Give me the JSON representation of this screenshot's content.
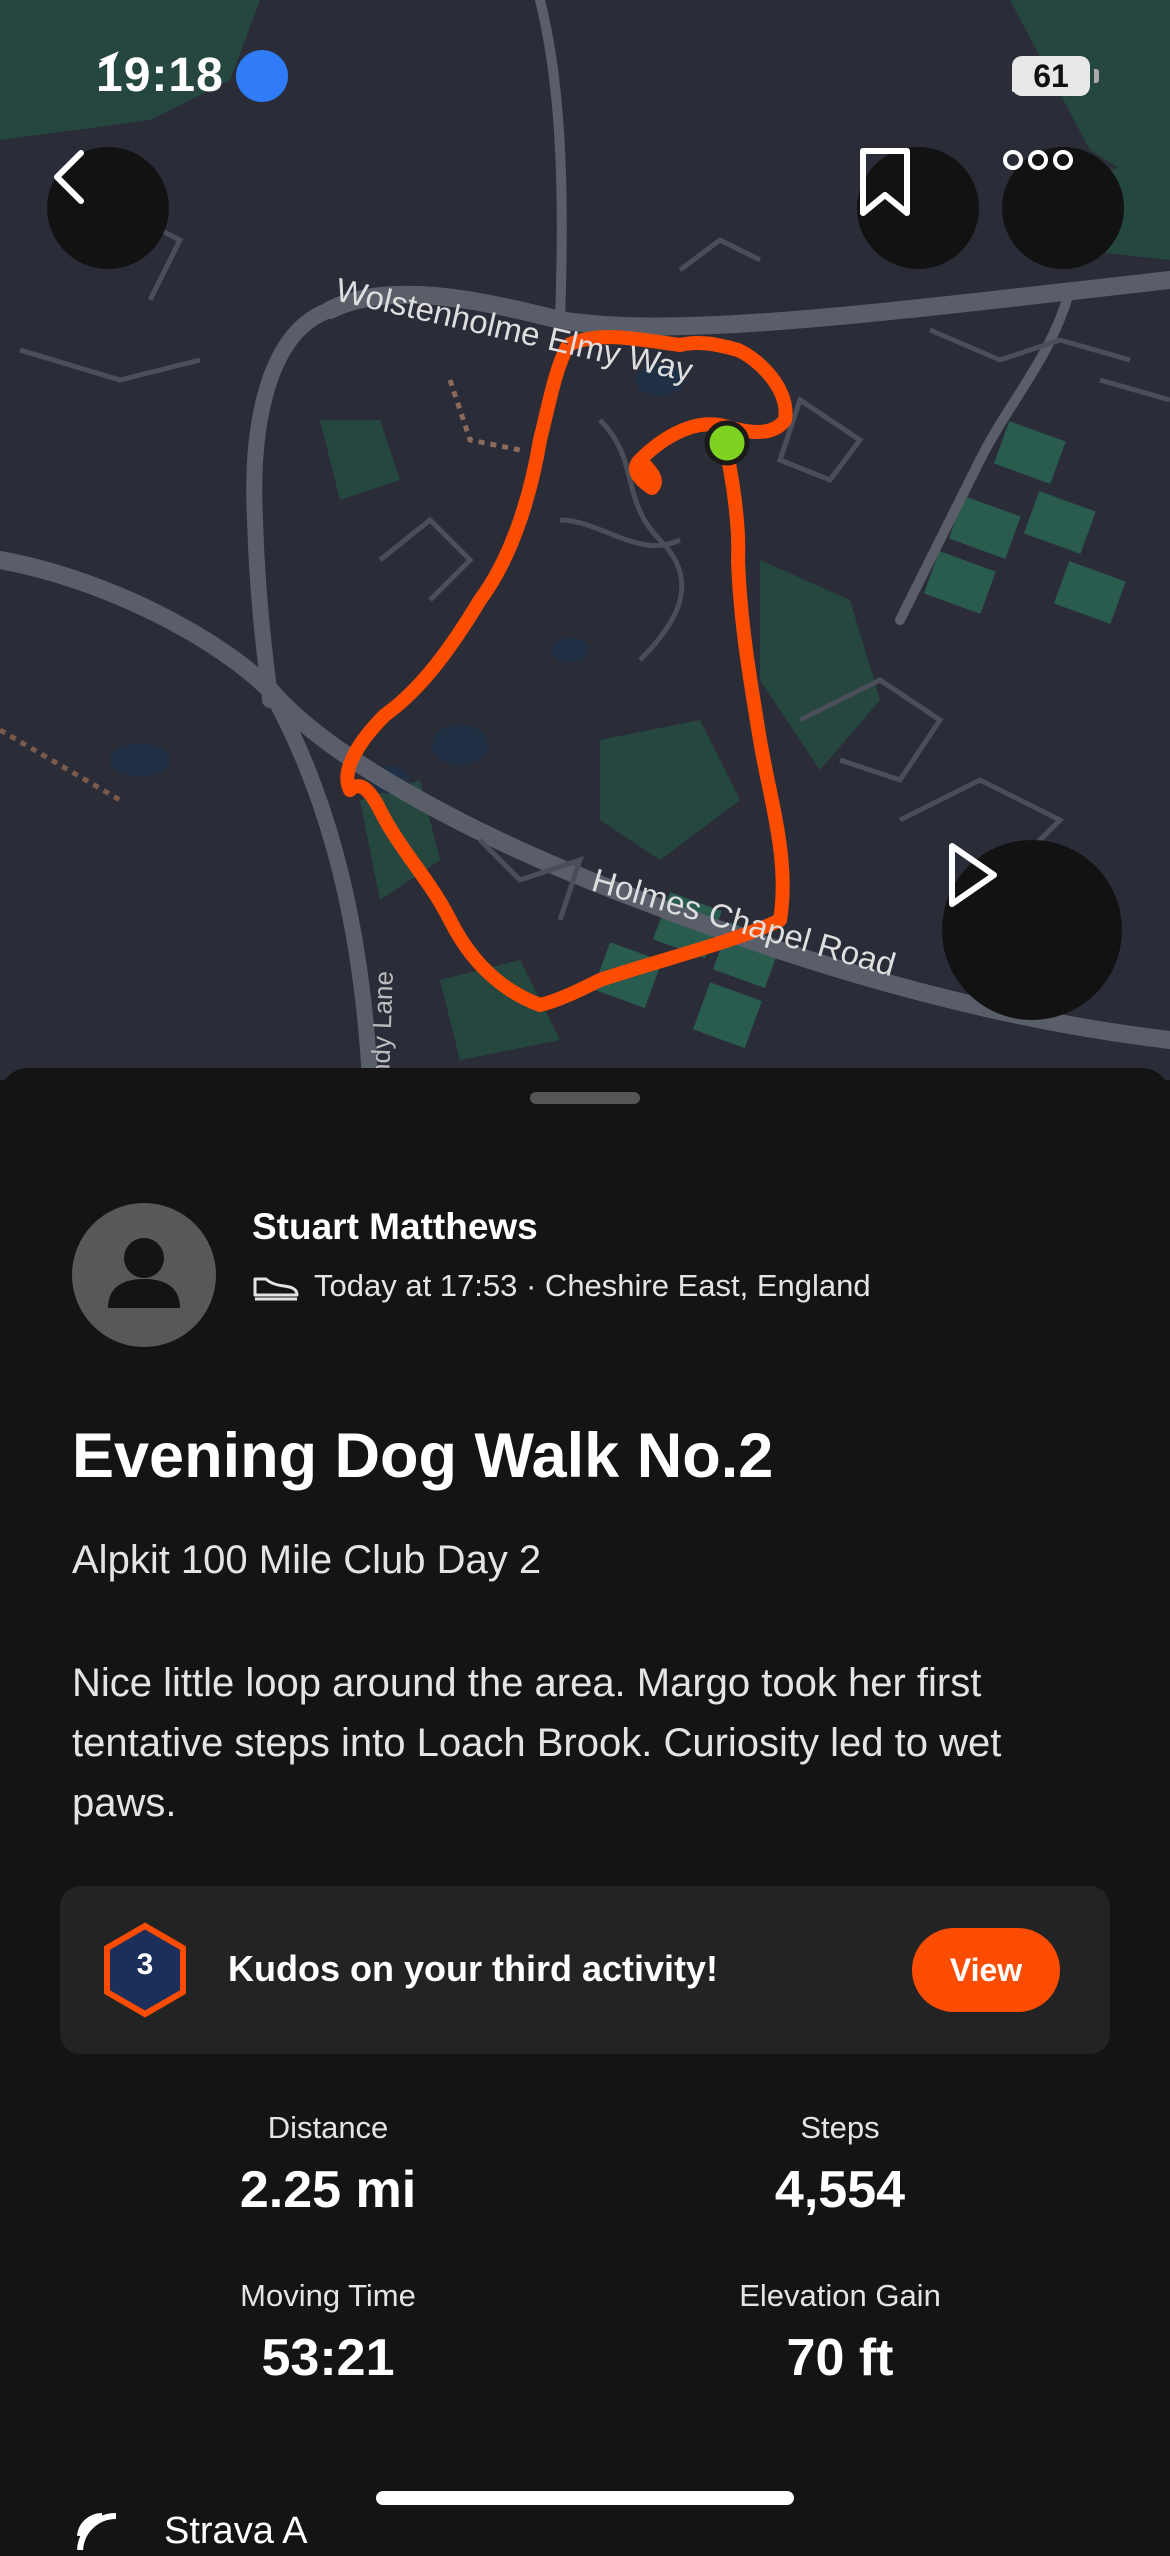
{
  "status_bar": {
    "time": "19:18",
    "battery": "61"
  },
  "map": {
    "roads": [
      "Wolstenholme Elmy Way",
      "Holmes Chapel Road",
      "Sandy Lane"
    ],
    "route_color": "#fc4c02",
    "start_marker_color": "#7ed321"
  },
  "activity": {
    "athlete": "Stuart Matthews",
    "meta": "Today at 17:53 · Cheshire East, England",
    "title": "Evening Dog Walk No.2",
    "subtitle": "Alpkit 100 Mile Club Day 2",
    "description": "Nice little loop around the area. Margo took her first tentative steps into Loach Brook. Curiosity led to wet paws."
  },
  "kudos": {
    "badge_number": "3",
    "text": "Kudos on your third activity!",
    "button": "View"
  },
  "stats": [
    {
      "label": "Distance",
      "value": "2.25 mi"
    },
    {
      "label": "Steps",
      "value": "4,554"
    },
    {
      "label": "Moving Time",
      "value": "53:21"
    },
    {
      "label": "Elevation Gain",
      "value": "70 ft"
    }
  ],
  "footer_partial": "Strava A",
  "colors": {
    "accent": "#fc4c02",
    "sheet_bg": "#141414",
    "card_bg": "#232323"
  }
}
